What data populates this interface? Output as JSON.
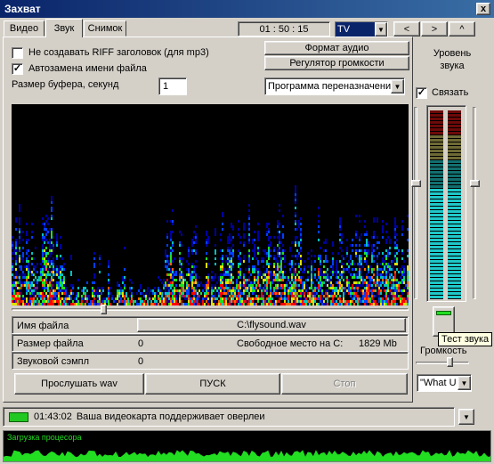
{
  "window": {
    "title": "Захват",
    "close_label": "x"
  },
  "tabs": [
    {
      "label": "Видео"
    },
    {
      "label": "Звук"
    },
    {
      "label": "Снимок"
    }
  ],
  "toolbar": {
    "timer": "01 : 50 : 15",
    "source_select": "TV",
    "nav_prev": "<",
    "nav_next": ">",
    "nav_up": "^"
  },
  "options": {
    "no_riff_label": "Не создавать RIFF заголовок (для mp3)",
    "no_riff_checked": false,
    "auto_rename_label": "Автозамена имени файла",
    "auto_rename_checked": true,
    "buffer_label": "Размер буфера, секунд",
    "buffer_value": "1"
  },
  "buttons": {
    "audio_format": "Формат аудио",
    "volume_control": "Регулятор громкости",
    "reassign_program": "Программа переназначени",
    "listen_wav": "Прослушать wav",
    "start": "ПУСК",
    "stop": "Стоп"
  },
  "file_info": {
    "name_label": "Имя файла",
    "name_value": "C:\\flysound.wav",
    "size_label": "Размер файла",
    "size_value": "0",
    "free_label": "Свободное место на C:",
    "free_value": "1829 Mb",
    "sample_label": "Звуковой сэмпл",
    "sample_value": "0"
  },
  "right_panel": {
    "level_label_1": "Уровень",
    "level_label_2": "звука",
    "link_label": "Связать",
    "link_checked": true,
    "tooltip": "Тест звука",
    "volume_label": "Громкость",
    "input_select": "\"What U"
  },
  "status": {
    "time": "01:43:02",
    "message": "Ваша видеокарта поддерживает оверлеи",
    "cpu_label": "Загрузка процесора"
  },
  "colors": {
    "title_start": "#0a246a",
    "title_end": "#3a6ea5",
    "select_bg": "#0a246a",
    "meter_red": "#c41010",
    "meter_yellow": "#c8c060",
    "meter_cyan": "#20c8c8",
    "status_green": "#22c822",
    "cpu_green": "#22dd22"
  }
}
